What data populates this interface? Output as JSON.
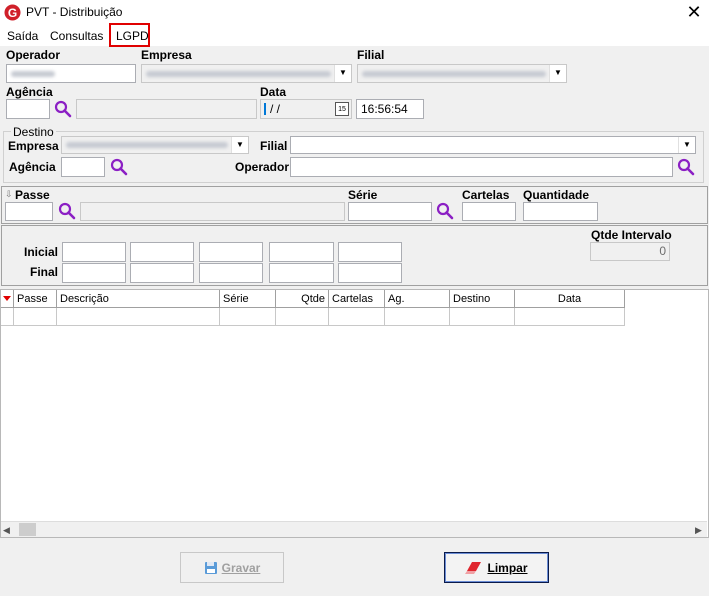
{
  "window": {
    "title": "PVT - Distribuição",
    "close_glyph": "✕",
    "icon": "app-logo-icon"
  },
  "menu": {
    "items": [
      "Saída",
      "Consultas",
      "LGPD"
    ]
  },
  "header": {
    "operador_label": "Operador",
    "empresa_label": "Empresa",
    "filial_label": "Filial",
    "agencia_label": "Agência",
    "data_label": "Data",
    "date_value": "/ /",
    "calendar_glyph": "15",
    "time_value": "16:56:54"
  },
  "destino": {
    "group_label": "Destino",
    "empresa_label": "Empresa",
    "filial_label": "Filial",
    "agencia_label": "Agência",
    "operador_label": "Operador"
  },
  "passe_panel": {
    "passe_label": "Passe",
    "serie_label": "Série",
    "cartelas_label": "Cartelas",
    "quantidade_label": "Quantidade"
  },
  "interval_panel": {
    "inicial_label": "Inicial",
    "final_label": "Final",
    "qtde_label": "Qtde Intervalo",
    "qtde_value": "0"
  },
  "grid": {
    "columns": [
      "Passe",
      "Descrição",
      "Série",
      "Qtde",
      "Cartelas",
      "Ag.",
      "Destino",
      "Data"
    ]
  },
  "buttons": {
    "gravar": "Gravar",
    "limpar": "Limpar"
  },
  "colors": {
    "accent": "#0078d7",
    "search_icon": "#8b1fc4",
    "highlight_box": "#e00000",
    "sort_arrow": "#e00000"
  }
}
